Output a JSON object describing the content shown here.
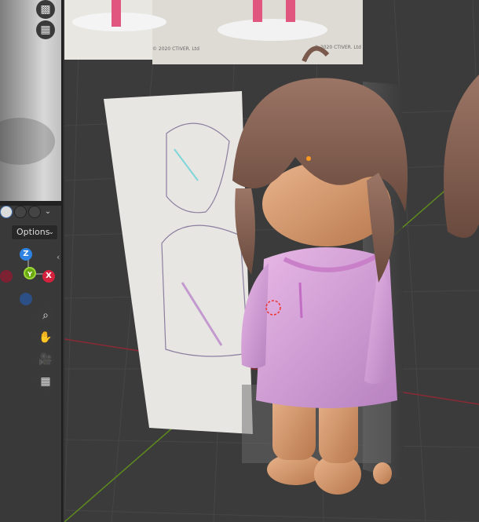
{
  "left_panel": {
    "shading_modes": [
      "solid-shading",
      "material-preview",
      "rendered"
    ],
    "options_label": "Options",
    "gizmo": {
      "z": "Z",
      "y": "Y",
      "x": "X"
    }
  },
  "references": {
    "top_copyright": "© 2020 CTIVER. Ltd",
    "top_left_copyright": "© 2020 CTIVER. Ltd"
  },
  "colors": {
    "x_axis": "#ff3352",
    "y_axis": "#8bdc00",
    "z_axis": "#2f83e3",
    "hoodie": "#d9a5d8",
    "hair": "#8a6656"
  }
}
